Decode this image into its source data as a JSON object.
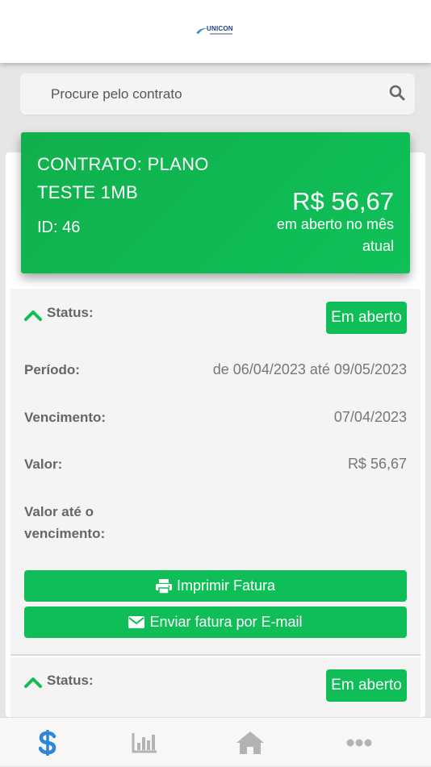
{
  "header": {
    "logo_text": "UNICON"
  },
  "search": {
    "placeholder": "Procure pelo contrato",
    "icon": "search-icon"
  },
  "contract": {
    "name": "CONTRATO: PLANO TESTE 1MB",
    "id_label": "ID: 46",
    "amount": "R$ 56,67",
    "amount_caption": "em aberto no mês atual",
    "color": "#0fbe56"
  },
  "invoices": [
    {
      "status_label": "Status:",
      "status_badge": "Em aberto",
      "period_label": "Período:",
      "period_value": "de 06/04/2023 até 09/05/2023",
      "due_label": "Vencimento:",
      "due_value": "07/04/2023",
      "value_label": "Valor:",
      "value_value": "R$ 56,67",
      "value_due_label": "Valor até o vencimento:",
      "print_button": "Imprimir Fatura",
      "email_button": "Enviar fatura por E-mail"
    },
    {
      "status_label": "Status:",
      "status_badge": "Em aberto"
    }
  ],
  "bottom_nav": [
    {
      "icon": "dollar-icon",
      "active": true,
      "color": "#2f86d6"
    },
    {
      "icon": "bar-chart-icon",
      "active": false,
      "color": "#b3b3b3"
    },
    {
      "icon": "home-icon",
      "active": false,
      "color": "#b3b3b3"
    },
    {
      "icon": "more-icon",
      "active": false,
      "color": "#b3b3b3"
    }
  ]
}
